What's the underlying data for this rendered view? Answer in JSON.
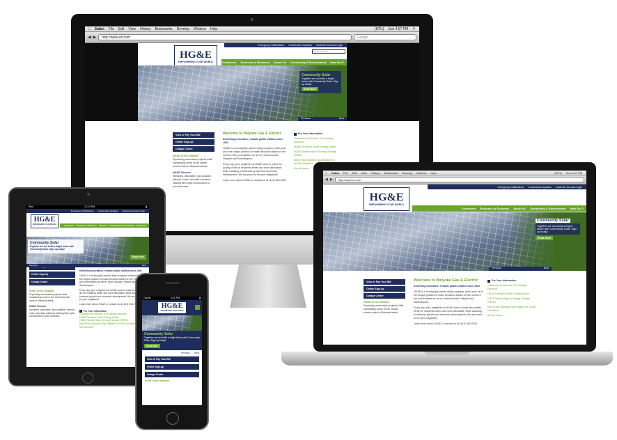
{
  "site": {
    "logo_text": "HG&E",
    "tagline": "EMPOWERING YOUR WORLD",
    "topbar": [
      "Emergency Notifications",
      "Construction Updates",
      "Customer Account Login"
    ],
    "search_placeholder": "Search this site",
    "nav": [
      "Customers",
      "Business to Business",
      "About Us",
      "Community & Environment",
      "How Do I?"
    ],
    "hero": {
      "title": "Community Solar",
      "text": "Together we can build a bright future with Community Solar. Sign up today!",
      "button": "Read More",
      "prev": "Previous",
      "next": "Next"
    },
    "sidebar_buttons": [
      "View or Pay Your Bill",
      "Online Sign-up",
      "Outage Center"
    ],
    "green": {
      "title": "HG&E Green Initiative",
      "text": "Expanding renewable projects while maintaining some of the lowest electric rates in Massachusetts."
    },
    "telecom": {
      "title": "HG&E Telecom",
      "text": "Websites, affordable, and scalable, internet, voice, and data solutions utilizing fiber optic connections to your business."
    },
    "main": {
      "title": "Welcome to Holyoke Gas & Electric",
      "subtitle": "Delivering innovative, reliable public utilities since 1902",
      "p1": "HG&E is a municipally-owned utility company, which puts us in the unique position to make decisions based on the needs of the communities we serve, which include Holyoke and Southampton.",
      "p2": "Every day, your neighbors at HG&E work to make the quality of life for residents better and more affordable, while assisting in business growth and economic development. We are proud to be your neighbors!",
      "p3": "Learn more about HG&E or contact us at (413) 536-9300"
    },
    "info": {
      "title": "For Your Information",
      "items": [
        "Customers to Receive 10% Holiday Discount",
        "HG&E Receives Smart Energy Award",
        "HG&E Named High in Energy Storage (SEPA)",
        "New Pump Systems Now Eligible for HG&E Incentives"
      ],
      "more": "See all news..."
    }
  },
  "desktop": {
    "menubar": [
      "Safari",
      "File",
      "Edit",
      "View",
      "History",
      "Bookmarks",
      "Develop",
      "Window",
      "Help"
    ],
    "status_right": "Sun 4:57 PM",
    "battery": "(87%)",
    "url": "http://www.url.com",
    "search_placeholder": "Google"
  },
  "laptop": {
    "menubar": [
      "Safari",
      "File",
      "Edit",
      "View",
      "History",
      "Bookmarks",
      "Develop",
      "Window",
      "Help"
    ],
    "status_right": "Sun 4:57 PM",
    "battery": "(87%)",
    "url": "http://www.url.com"
  },
  "tablet": {
    "carrier": "iPad",
    "time": "12:13 PM"
  },
  "phone": {
    "carrier": "Carrier",
    "time": "4:41 PM"
  },
  "colors": {
    "navy": "#1f2d5c",
    "green": "#6aa52c"
  }
}
